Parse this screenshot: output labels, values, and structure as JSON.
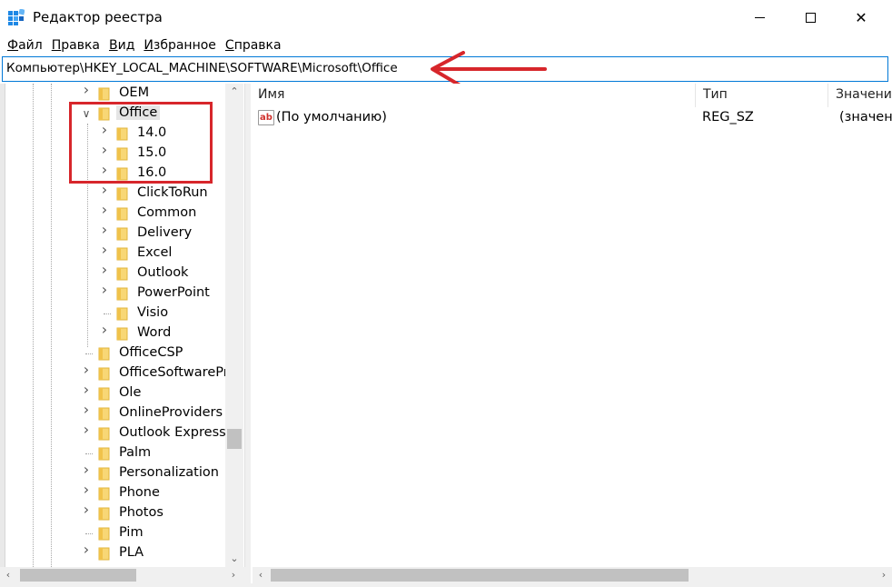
{
  "window": {
    "title": "Редактор реестра",
    "controls": {
      "minimize": "",
      "maximize": "",
      "close": "✕"
    }
  },
  "menu": [
    "Файл",
    "Правка",
    "Вид",
    "Избранное",
    "Справка"
  ],
  "address": "Компьютер\\HKEY_LOCAL_MACHINE\\SOFTWARE\\Microsoft\\Office",
  "tree": {
    "items": [
      {
        "label": "OEM",
        "level": 1,
        "expander": "collapsed"
      },
      {
        "label": "Office",
        "level": 1,
        "expander": "expanded",
        "selected": true
      },
      {
        "label": "14.0",
        "level": 2,
        "expander": "collapsed"
      },
      {
        "label": "15.0",
        "level": 2,
        "expander": "collapsed"
      },
      {
        "label": "16.0",
        "level": 2,
        "expander": "collapsed"
      },
      {
        "label": "ClickToRun",
        "level": 2,
        "expander": "collapsed"
      },
      {
        "label": "Common",
        "level": 2,
        "expander": "collapsed"
      },
      {
        "label": "Delivery",
        "level": 2,
        "expander": "collapsed"
      },
      {
        "label": "Excel",
        "level": 2,
        "expander": "collapsed"
      },
      {
        "label": "Outlook",
        "level": 2,
        "expander": "collapsed"
      },
      {
        "label": "PowerPoint",
        "level": 2,
        "expander": "collapsed"
      },
      {
        "label": "Visio",
        "level": 2,
        "expander": "none"
      },
      {
        "label": "Word",
        "level": 2,
        "expander": "collapsed"
      },
      {
        "label": "OfficeCSP",
        "level": 1,
        "expander": "none"
      },
      {
        "label": "OfficeSoftwarePro",
        "level": 1,
        "expander": "collapsed"
      },
      {
        "label": "Ole",
        "level": 1,
        "expander": "collapsed"
      },
      {
        "label": "OnlineProviders",
        "level": 1,
        "expander": "collapsed"
      },
      {
        "label": "Outlook Express",
        "level": 1,
        "expander": "collapsed"
      },
      {
        "label": "Palm",
        "level": 1,
        "expander": "none"
      },
      {
        "label": "Personalization",
        "level": 1,
        "expander": "collapsed"
      },
      {
        "label": "Phone",
        "level": 1,
        "expander": "collapsed"
      },
      {
        "label": "Photos",
        "level": 1,
        "expander": "collapsed"
      },
      {
        "label": "Pim",
        "level": 1,
        "expander": "none"
      },
      {
        "label": "PLA",
        "level": 1,
        "expander": "collapsed"
      }
    ]
  },
  "list": {
    "columns": [
      "Имя",
      "Тип",
      "Значени"
    ],
    "rows": [
      {
        "icon": "string-value-icon",
        "icon_text": "ab",
        "name": "(По умолчанию)",
        "type": "REG_SZ",
        "value": "(значен"
      }
    ]
  },
  "annotations": {
    "highlight_color": "#d7262b",
    "arrow_color": "#d7262b"
  }
}
